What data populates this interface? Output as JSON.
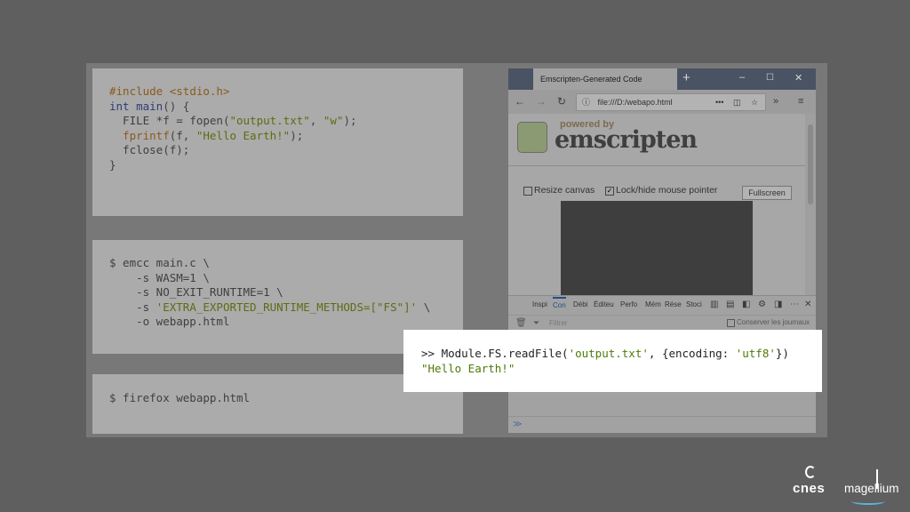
{
  "code_c": {
    "include_kw": "#include",
    "include_hdr": "<stdio.h>",
    "main_type": "int",
    "main_name": "main",
    "main_rest": "() {",
    "l3_a": "  FILE *f = ",
    "l3_fn": "fopen",
    "l3_b": "(",
    "l3_s1": "\"output.txt\"",
    "l3_c": ", ",
    "l3_s2": "\"w\"",
    "l3_d": ");",
    "l4_fn": "  fprintf",
    "l4_a": "(f, ",
    "l4_s": "\"Hello Earth!\"",
    "l4_b": ");",
    "l5": "  fclose(f);",
    "l6": "}"
  },
  "code_build": {
    "l1": "$ emcc main.c \\",
    "l2": "    -s WASM=1 \\",
    "l3": "    -s NO_EXIT_RUNTIME=1 \\",
    "l4_a": "    -s ",
    "l4_s": "'EXTRA_EXPORTED_RUNTIME_METHODS=[\"FS\"]'",
    "l4_b": " \\",
    "l5": "    -o webapp.html"
  },
  "code_run": {
    "l1": "$ firefox webapp.html"
  },
  "browser": {
    "tab_title": "Emscripten-Generated Code",
    "url": "file:///D:/webapo.html",
    "logo_powered": "powered by",
    "logo_name": "emscripten",
    "resize_label": "Resize canvas",
    "lock_label": "Lock/hide mouse pointer",
    "fullscreen_label": "Fullscreen",
    "devtools_tabs": [
      "Inspi",
      "Con",
      "Débi",
      "Éditeu",
      "Perfo",
      "Mém",
      "Rése",
      "Stoci"
    ],
    "filter_placeholder": "Filtrer",
    "persist_label": "Conserver les journaux"
  },
  "console_popup": {
    "prompt": ">> ",
    "cmd_a": "Module.FS.readFile(",
    "cmd_s1": "'output.txt'",
    "cmd_b": ", {encoding: ",
    "cmd_s2": "'utf8'",
    "cmd_c": "})",
    "result": "\"Hello Earth!\""
  },
  "logos": {
    "cnes": "cnes",
    "magellium": "magellium"
  },
  "colors": {
    "page_bg": "#5f5f5f",
    "panel_bg": "#787878",
    "card_bg": "#ababab",
    "string": "#5f6b13",
    "keyword": "#2a3f7a",
    "preprocessor": "#8a5a1c"
  }
}
